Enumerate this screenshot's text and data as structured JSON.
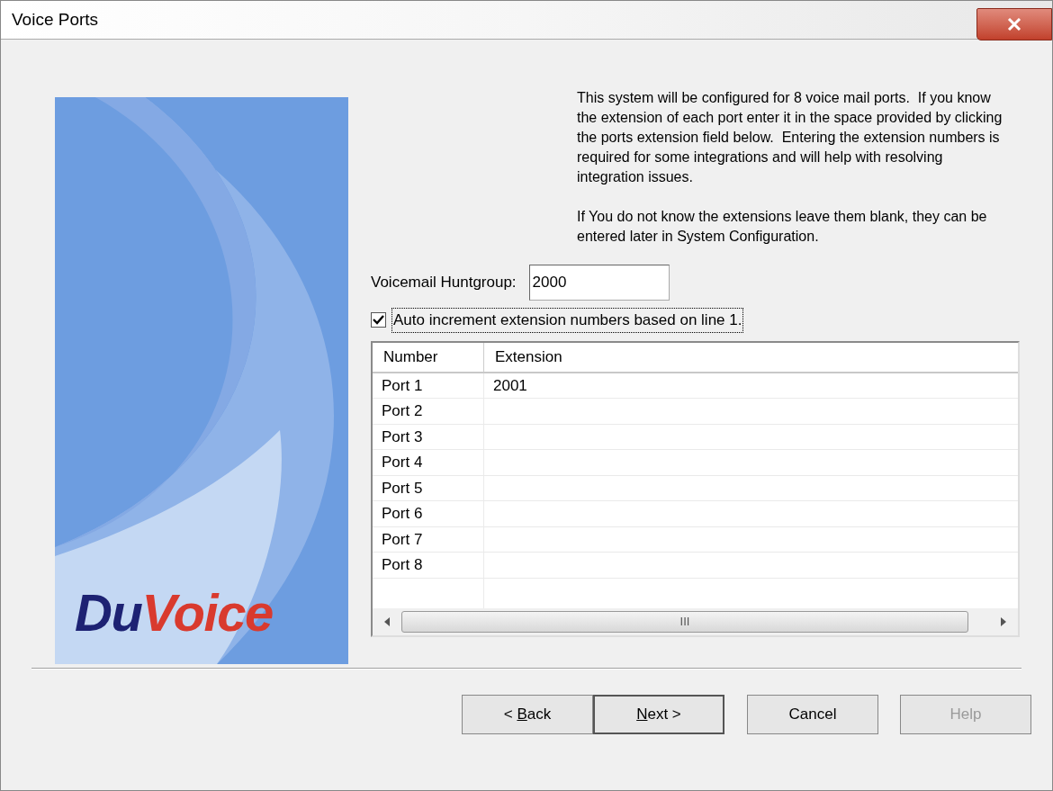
{
  "window": {
    "title": "Voice Ports"
  },
  "logo": {
    "first": "Du",
    "second": "Voice"
  },
  "paragraphs": [
    "This system will be configured for 8 voice mail ports.  If you know the extension of each port enter it in the space provided by clicking the ports extension field below.  Entering the extension numbers is required for some integrations and will help with resolving integration issues.",
    "If You do not know the extensions leave them blank, they can be entered later in System Configuration."
  ],
  "huntgroup": {
    "label": "Voicemail Huntgroup:",
    "value": "2000"
  },
  "auto_increment": {
    "label": "Auto increment extension numbers based on line 1.",
    "checked": true,
    "focused": true
  },
  "table": {
    "columns": [
      "Number",
      "Extension"
    ],
    "rows": [
      {
        "number": "Port 1",
        "extension": "2001"
      },
      {
        "number": "Port 2"
      },
      {
        "number": "Port 3"
      },
      {
        "number": "Port 4"
      },
      {
        "number": "Port 5"
      },
      {
        "number": "Port 6"
      },
      {
        "number": "Port 7"
      },
      {
        "number": "Port 8"
      }
    ],
    "scrollbar_grip": "III"
  },
  "buttons": [
    {
      "before": "< ",
      "key": "B",
      "after": "ack",
      "default": false,
      "disabled": false
    },
    {
      "key": "N",
      "after": "ext >",
      "default": true,
      "disabled": false
    },
    {
      "before": "Cancel",
      "default": false,
      "disabled": false
    },
    {
      "before": "Help",
      "default": false,
      "disabled": true
    }
  ]
}
